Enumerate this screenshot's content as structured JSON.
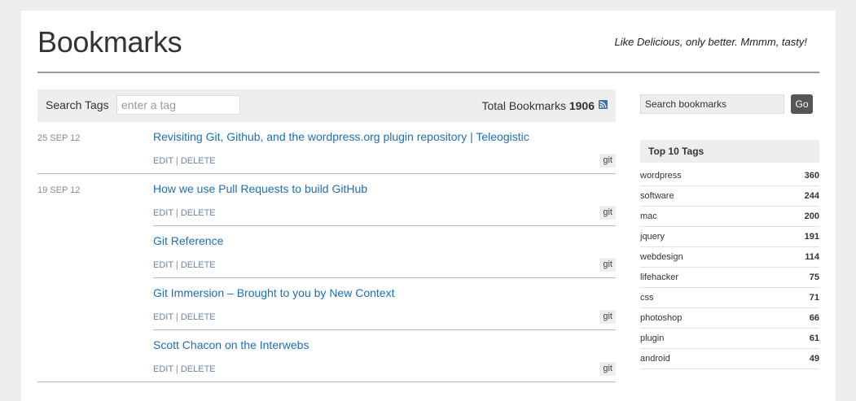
{
  "header": {
    "title": "Bookmarks",
    "tagline": "Like Delicious, only better. Mmmm, tasty!"
  },
  "search_tags": {
    "label": "Search Tags",
    "placeholder": "enter a tag",
    "total_label": "Total Bookmarks",
    "total_count": "1906"
  },
  "days": [
    {
      "date": "25 SEP 12",
      "bookmarks": [
        {
          "title": "Revisiting Git, Github, and the wordpress.org plugin repository | Teleogistic",
          "edit": "EDIT",
          "delete": "DELETE",
          "tag": "git"
        }
      ]
    },
    {
      "date": "19 SEP 12",
      "bookmarks": [
        {
          "title": "How we use Pull Requests to build GitHub",
          "edit": "EDIT",
          "delete": "DELETE",
          "tag": "git"
        },
        {
          "title": "Git Reference",
          "edit": "EDIT",
          "delete": "DELETE",
          "tag": "git"
        },
        {
          "title": "Git Immersion – Brought to you by New Context",
          "edit": "EDIT",
          "delete": "DELETE",
          "tag": "git"
        },
        {
          "title": "Scott Chacon on the Interwebs",
          "edit": "EDIT",
          "delete": "DELETE",
          "tag": "git"
        }
      ]
    }
  ],
  "sidebar": {
    "search_placeholder": "Search bookmarks",
    "go_label": "Go",
    "top_tags_title": "Top 10 Tags",
    "top_tags": [
      {
        "name": "wordpress",
        "count": "360"
      },
      {
        "name": "software",
        "count": "244"
      },
      {
        "name": "mac",
        "count": "200"
      },
      {
        "name": "jquery",
        "count": "191"
      },
      {
        "name": "webdesign",
        "count": "114"
      },
      {
        "name": "lifehacker",
        "count": "75"
      },
      {
        "name": "css",
        "count": "71"
      },
      {
        "name": "photoshop",
        "count": "66"
      },
      {
        "name": "plugin",
        "count": "61"
      },
      {
        "name": "android",
        "count": "49"
      }
    ]
  },
  "colors": {
    "link": "#1a6fbf",
    "rss": "#3a6fb0",
    "button": "#555555"
  },
  "icons": {
    "rss": "rss-icon"
  }
}
